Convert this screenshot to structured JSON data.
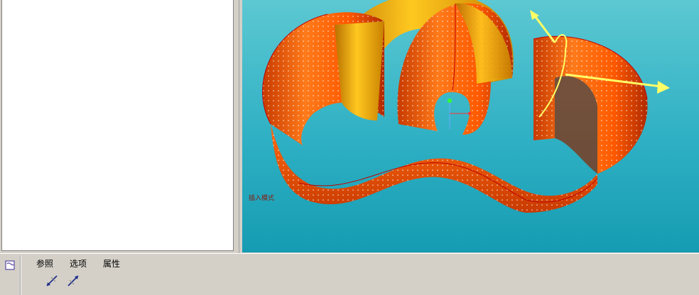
{
  "viewport": {
    "model_label": "插入模式",
    "colors": {
      "background_top": "#5cc8d2",
      "background_bottom": "#159cb2",
      "surface_orange": "#ff6a10",
      "surface_gold": "#f0a800",
      "edge_red": "#c00000",
      "axis_yellow": "#ffff66"
    }
  },
  "dashboard": {
    "icon": "sketch-feature-icon",
    "tabs": [
      {
        "label": "参照"
      },
      {
        "label": "选项"
      },
      {
        "label": "属性"
      }
    ],
    "tools": [
      {
        "icon": "edge-chain-icon"
      },
      {
        "icon": "edge-flip-icon"
      }
    ]
  }
}
